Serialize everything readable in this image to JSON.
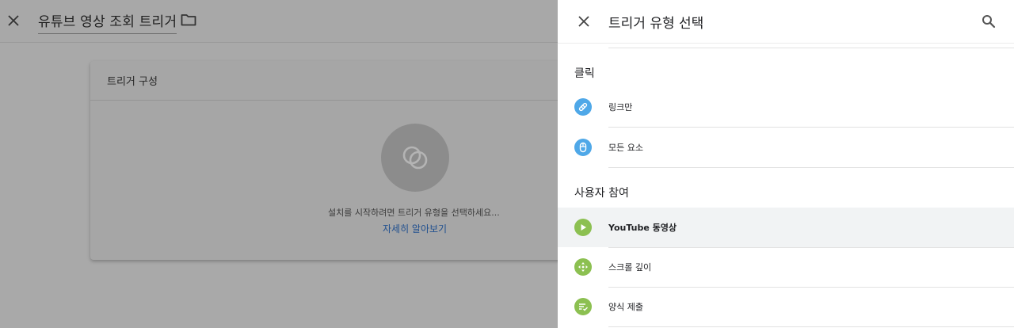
{
  "editor": {
    "title": "유튜브 영상 조회 트리거",
    "card": {
      "title": "트리거 구성",
      "hint": "설치를 시작하려면 트리거 유형을 선택하세요...",
      "link": "자세히 알아보기"
    }
  },
  "panel": {
    "title": "트리거 유형 선택",
    "sections": [
      {
        "heading": "클릭",
        "items": [
          {
            "label": "링크만",
            "icon": "link-icon",
            "color": "#4fa8e8"
          },
          {
            "label": "모든 요소",
            "icon": "mouse-icon",
            "color": "#4fa8e8"
          }
        ]
      },
      {
        "heading": "사용자 참여",
        "items": [
          {
            "label": "YouTube 동영상",
            "icon": "play-icon",
            "color": "#8cc051",
            "selected": true
          },
          {
            "label": "스크롤 깊이",
            "icon": "scroll-depth-icon",
            "color": "#8cc051"
          },
          {
            "label": "양식 제출",
            "icon": "form-icon",
            "color": "#8cc051"
          }
        ]
      }
    ]
  },
  "colors": {
    "overlay": "#a9a9a9",
    "link": "#1f4f8f",
    "click_blue": "#4fa8e8",
    "engagement_green": "#8cc051",
    "selected_row": "#f1f3f4"
  }
}
